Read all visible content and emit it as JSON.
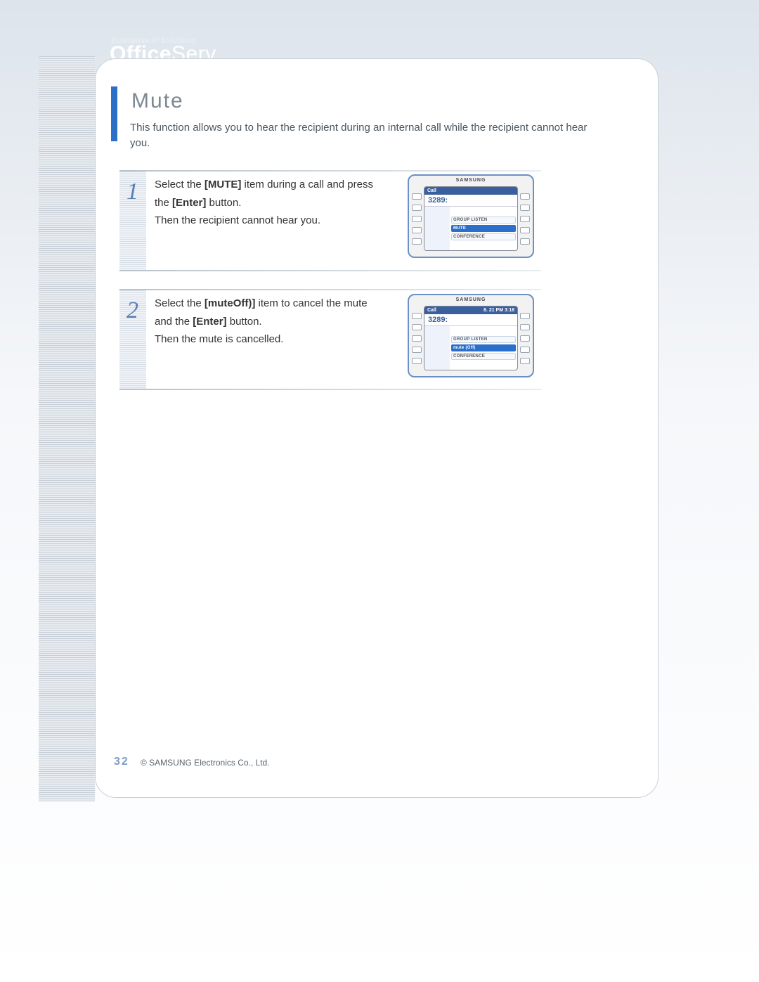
{
  "brand": {
    "tagline": "Enterprise IP Solutions",
    "name_bold": "Office",
    "name_light": "Serv"
  },
  "page": {
    "title": "Mute",
    "description": "This function allows you to hear the recipient during an internal call while the recipient cannot hear you.",
    "number": "32",
    "copyright": "© SAMSUNG Electronics Co., Ltd."
  },
  "steps": [
    {
      "num": "1",
      "text_segments": [
        "Select the ",
        "[MUTE]",
        " item during a call and press the ",
        "[Enter]",
        " button."
      ],
      "result": "Then the recipient cannot hear you.",
      "phone": {
        "maker": "SAMSUNG",
        "head_left": "Call",
        "head_right": "",
        "number": "3289:",
        "menu": [
          "GROUP LISTEN",
          "MUTE",
          "CONFERENCE"
        ],
        "selected": 1
      }
    },
    {
      "num": "2",
      "text_segments": [
        "Select the ",
        "[muteOff)]",
        " item to cancel the mute and the ",
        "[Enter]",
        " button."
      ],
      "result": "Then the mute is cancelled.",
      "phone": {
        "maker": "SAMSUNG",
        "head_left": "Call",
        "head_right": "8. 21  PM 3:18",
        "number": "3289:",
        "menu": [
          "GROUP LISTEN",
          "mute (Off)",
          "CONFERENCE"
        ],
        "selected": 1
      }
    }
  ]
}
